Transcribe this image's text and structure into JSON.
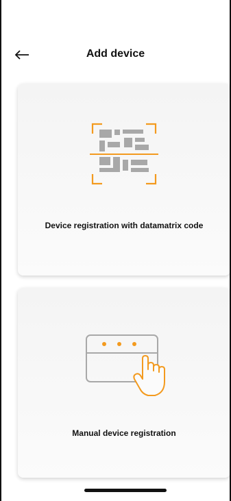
{
  "header": {
    "title": "Add device",
    "back_icon": "arrow-left-icon"
  },
  "options": [
    {
      "label": "Device registration with datamatrix code",
      "icon": "datamatrix-scan-icon"
    },
    {
      "label": "Manual device registration",
      "icon": "manual-entry-hand-icon"
    }
  ],
  "colors": {
    "accent": "#F39A1E",
    "icon_gray": "#A8A8A8",
    "text": "#111111"
  }
}
